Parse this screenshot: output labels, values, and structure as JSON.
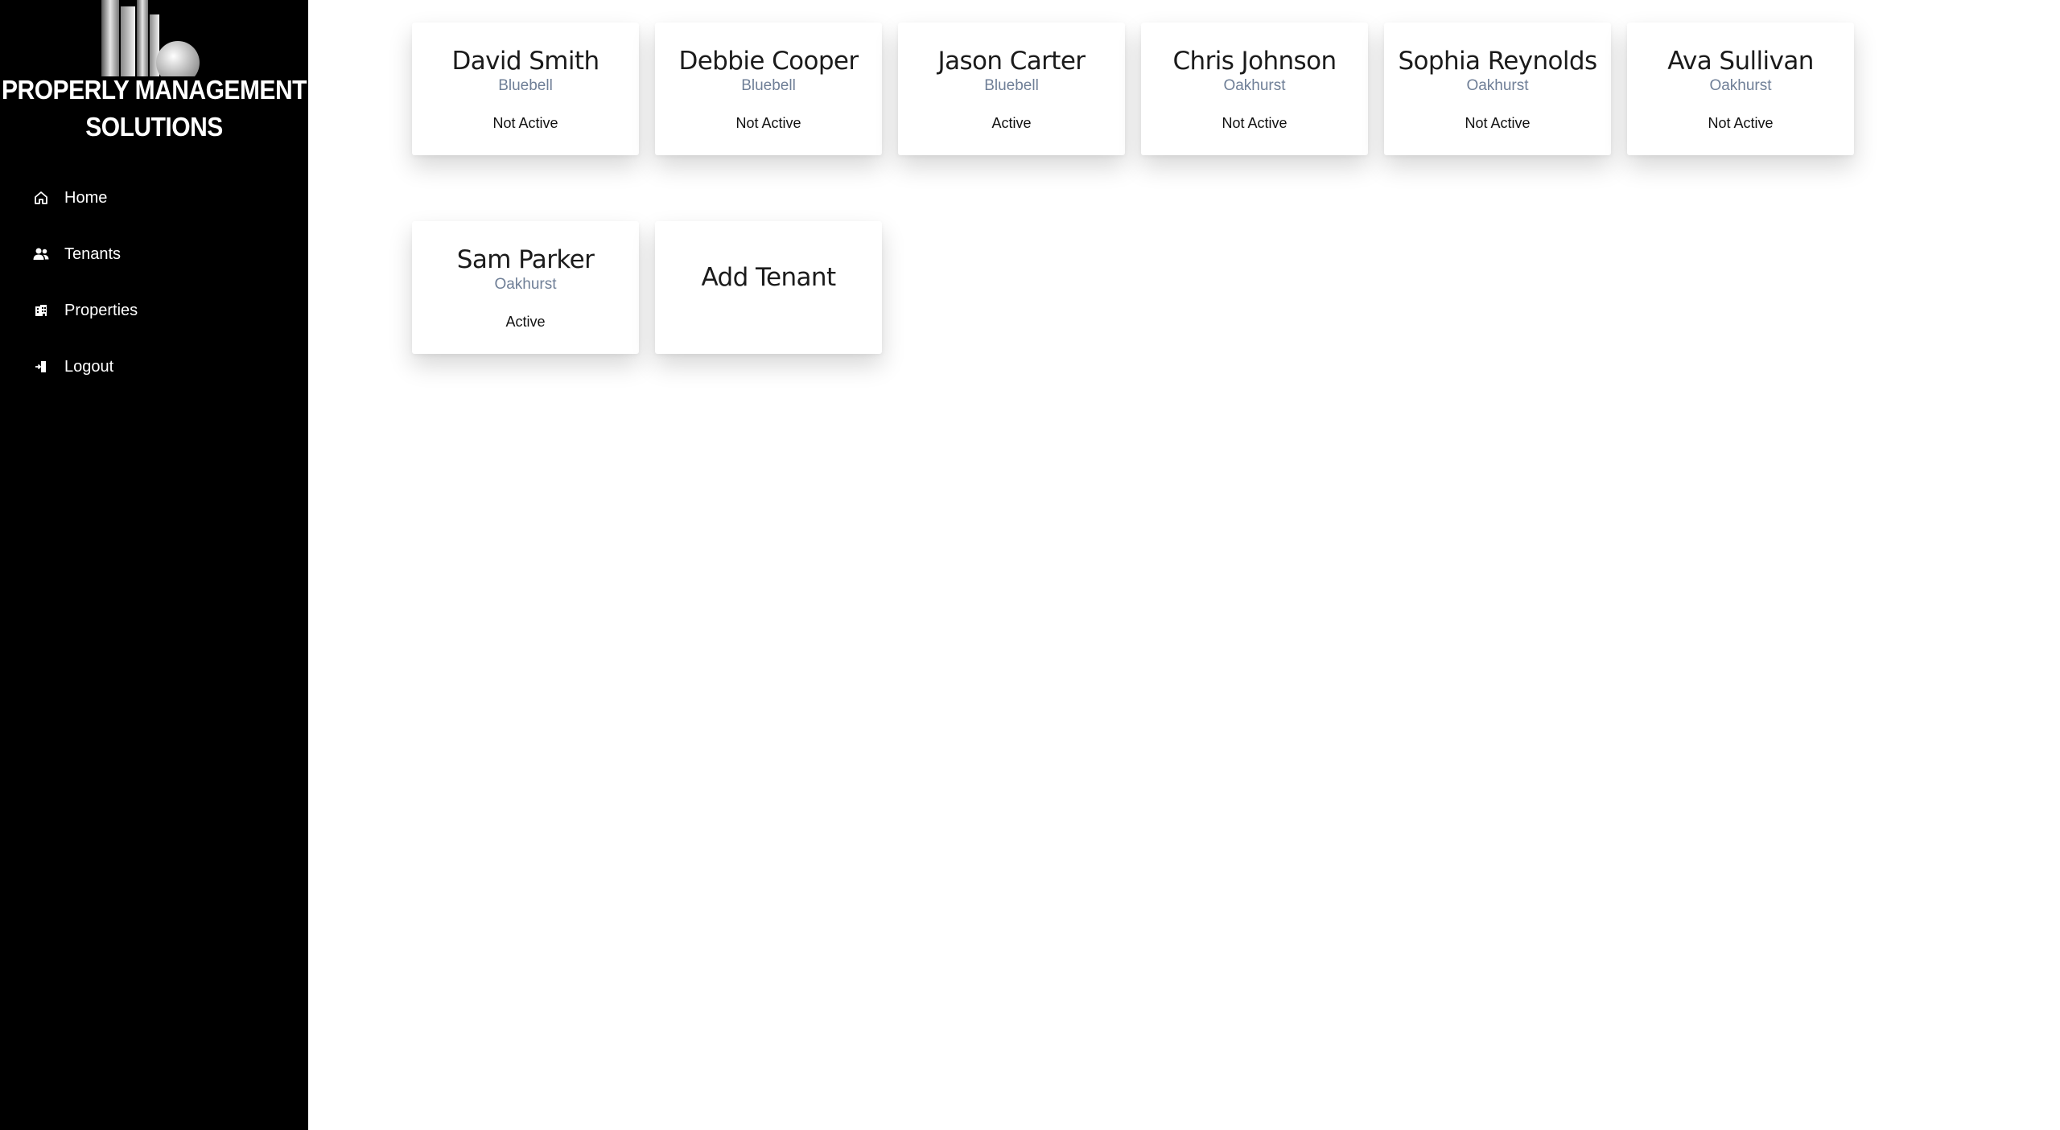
{
  "brand": {
    "line1": "PROPERLY MANAGEMENT",
    "line2": "SOLUTIONS",
    "logo_icon": "buildings-logo"
  },
  "sidebar": {
    "items": [
      {
        "label": "Home",
        "icon": "home-icon"
      },
      {
        "label": "Tenants",
        "icon": "users-icon"
      },
      {
        "label": "Properties",
        "icon": "building-icon"
      },
      {
        "label": "Logout",
        "icon": "logout-icon"
      }
    ]
  },
  "tenants": [
    {
      "name": "David Smith",
      "property": "Bluebell",
      "status": "Not Active"
    },
    {
      "name": "Debbie Cooper",
      "property": "Bluebell",
      "status": "Not Active"
    },
    {
      "name": "Jason Carter",
      "property": "Bluebell",
      "status": "Active"
    },
    {
      "name": "Chris Johnson",
      "property": "Oakhurst",
      "status": "Not Active"
    },
    {
      "name": "Sophia Reynolds",
      "property": "Oakhurst",
      "status": "Not Active"
    },
    {
      "name": "Ava Sullivan",
      "property": "Oakhurst",
      "status": "Not Active"
    },
    {
      "name": "Sam Parker",
      "property": "Oakhurst",
      "status": "Active"
    }
  ],
  "add_tenant": {
    "label": "Add Tenant"
  },
  "colors": {
    "sidebar_bg": "#000000",
    "property_text": "#6f7f97",
    "main_bg": "#ffffff"
  }
}
